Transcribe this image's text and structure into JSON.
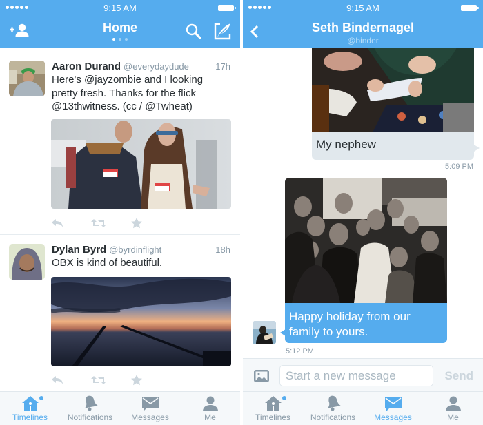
{
  "status_bar": {
    "time": "9:15 AM"
  },
  "colors": {
    "brand": "#55acee",
    "text": "#292f33",
    "muted": "#8899a6",
    "incoming_bubble": "#e1e8ed"
  },
  "home": {
    "title": "Home",
    "header_icons": [
      "add-user-icon",
      "search-icon",
      "compose-tweet-icon"
    ],
    "page_indicator": {
      "count": 3,
      "active": 1
    },
    "tweets": [
      {
        "name": "Aaron Durand",
        "handle": "@everydaydude",
        "time": "17h",
        "text": "Here's @jayzombie and I looking pretty fresh. Thanks for the flick @13thwitness.  (cc / @Twheat)",
        "media": "photo-two-people-with-name-tags"
      },
      {
        "name": "Dylan Byrd",
        "handle": "@byrdinflight",
        "time": "18h",
        "text": "OBX is kind of beautiful.",
        "media": "photo-sunset-over-water-pier"
      }
    ],
    "tweet_actions": [
      "reply-icon",
      "retweet-icon",
      "favorite-icon"
    ]
  },
  "conversation": {
    "contact_name": "Seth Bindernagel",
    "contact_handle": "@binder",
    "messages": [
      {
        "direction": "incoming",
        "media": "photo-child-at-table",
        "text": "My nephew",
        "time": "5:09 PM"
      },
      {
        "direction": "outgoing",
        "media": "photo-family-group",
        "text": "Happy holiday from our family to yours.",
        "time": "5:12 PM"
      }
    ],
    "composer": {
      "placeholder": "Start a new message",
      "send_label": "Send"
    }
  },
  "tabs_left": [
    {
      "label": "Timelines",
      "icon": "home-icon",
      "active": true,
      "badge": true
    },
    {
      "label": "Notifications",
      "icon": "bell-icon",
      "active": false
    },
    {
      "label": "Messages",
      "icon": "envelope-icon",
      "active": false
    },
    {
      "label": "Me",
      "icon": "person-icon",
      "active": false
    }
  ],
  "tabs_right": [
    {
      "label": "Timelines",
      "icon": "home-icon",
      "active": false,
      "badge": true
    },
    {
      "label": "Notifications",
      "icon": "bell-icon",
      "active": false
    },
    {
      "label": "Messages",
      "icon": "envelope-icon",
      "active": true
    },
    {
      "label": "Me",
      "icon": "person-icon",
      "active": false
    }
  ]
}
